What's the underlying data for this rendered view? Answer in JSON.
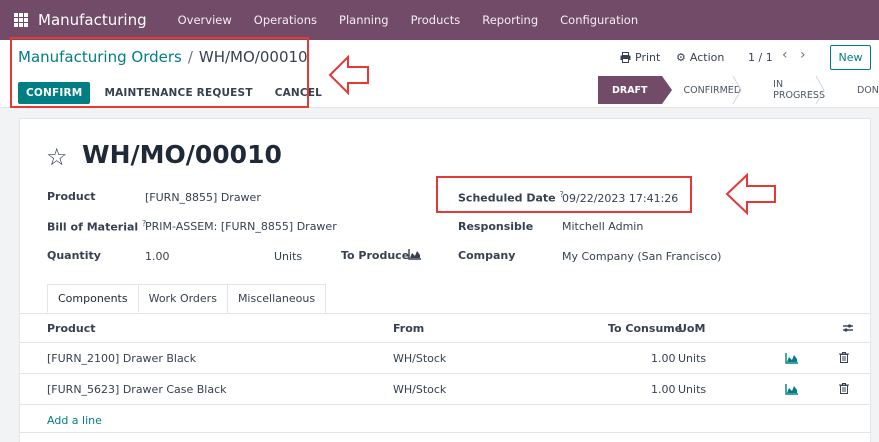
{
  "navbar": {
    "brand": "Manufacturing",
    "menu": [
      "Overview",
      "Operations",
      "Planning",
      "Products",
      "Reporting",
      "Configuration"
    ],
    "bg_color": "#714b67"
  },
  "breadcrumb": {
    "parent": "Manufacturing Orders",
    "separator": "/",
    "current": "WH/MO/00010"
  },
  "actions": {
    "confirm": "CONFIRM",
    "maintenance": "MAINTENANCE REQUEST",
    "cancel": "CANCEL"
  },
  "toolbar": {
    "print": "Print",
    "action": "Action",
    "pager": "1 / 1",
    "new": "New"
  },
  "status": {
    "stages": [
      "DRAFT",
      "CONFIRMED",
      "IN PROGRESS",
      "DONE"
    ],
    "active": "DRAFT"
  },
  "record": {
    "title": "WH/MO/00010",
    "fields": {
      "product_label": "Product",
      "product_value": "[FURN_8855] Drawer",
      "bom_label": "Bill of Material",
      "bom_value": "PRIM-ASSEM: [FURN_8855] Drawer",
      "quantity_label": "Quantity",
      "quantity_value": "1.00",
      "quantity_unit": "Units",
      "to_produce_label": "To Produce",
      "scheduled_label": "Scheduled Date",
      "scheduled_value": "09/22/2023 17:41:26",
      "responsible_label": "Responsible",
      "responsible_value": "Mitchell Admin",
      "company_label": "Company",
      "company_value": "My Company (San Francisco)",
      "help_mark": "?"
    }
  },
  "tabs": [
    "Components",
    "Work Orders",
    "Miscellaneous"
  ],
  "table": {
    "headers": {
      "product": "Product",
      "from": "From",
      "to_consume": "To Consume",
      "uom": "UoM"
    },
    "rows": [
      {
        "product": "[FURN_2100] Drawer Black",
        "from": "WH/Stock",
        "qty": "1.00",
        "uom": "Units"
      },
      {
        "product": "[FURN_5623] Drawer Case Black",
        "from": "WH/Stock",
        "qty": "1.00",
        "uom": "Units"
      }
    ],
    "add_line": "Add a line"
  },
  "colors": {
    "accent": "#017e84",
    "annotation": "#e53935"
  }
}
